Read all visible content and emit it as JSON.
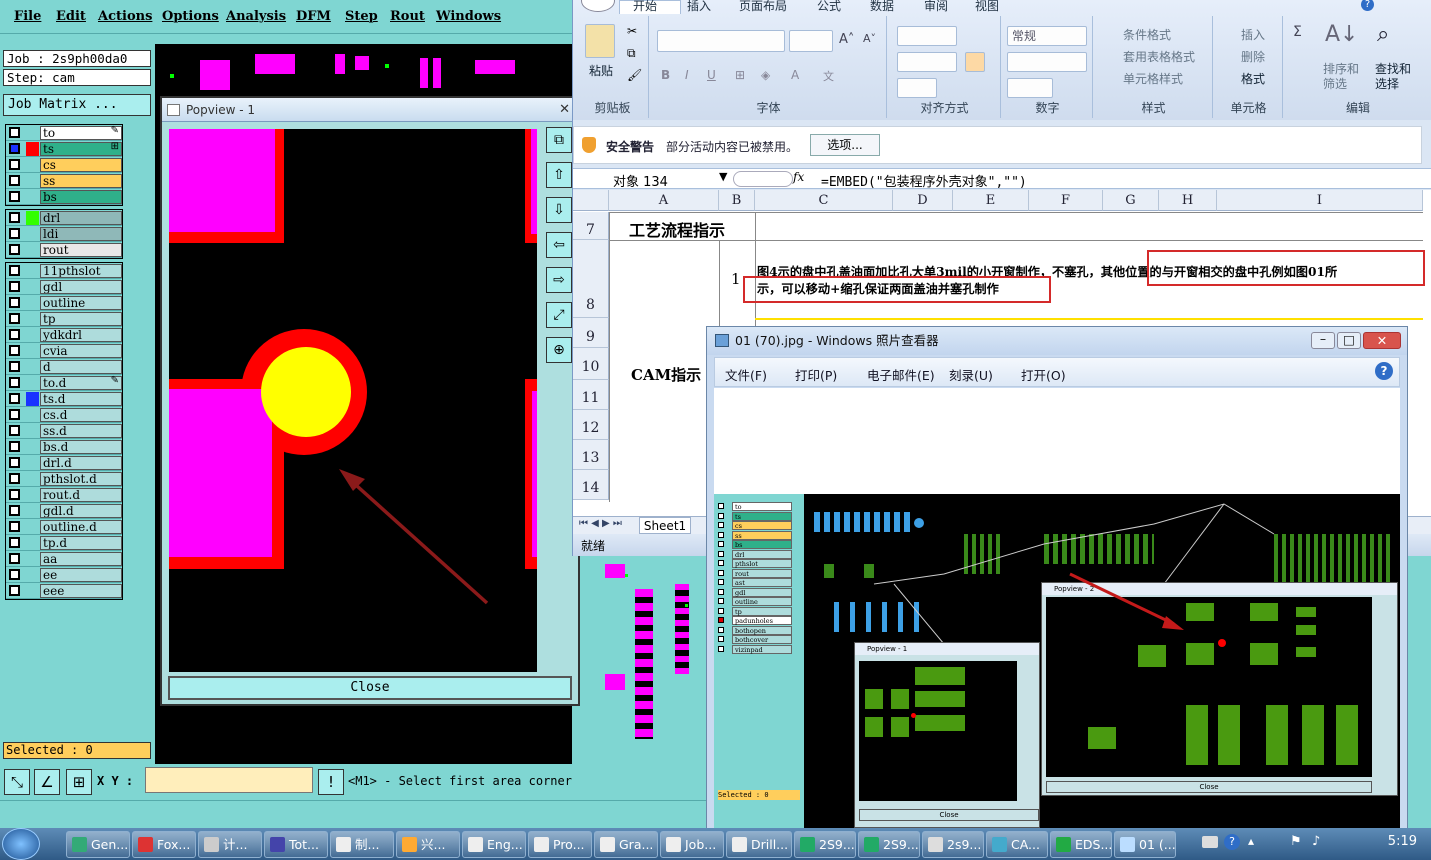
{
  "genesis": {
    "menu": [
      "File",
      "Edit",
      "Actions",
      "Options",
      "Analysis",
      "DFM",
      "Step",
      "Rout",
      "Windows"
    ],
    "job": "Job : 2s9ph00da0",
    "step": "Step: cam",
    "job_matrix": "Job Matrix ...",
    "layers_group1": [
      {
        "name": "to",
        "color": "#ffffff",
        "mark": "✎"
      },
      {
        "name": "ts",
        "color": "#ff0000",
        "mark": "⊞"
      },
      {
        "name": "cs",
        "color": "#ffce5c",
        "mark": ""
      },
      {
        "name": "ss",
        "color": "#ffce5c",
        "mark": ""
      },
      {
        "name": "bs",
        "color": "#2fb08a",
        "mark": ""
      }
    ],
    "layers_group2": [
      {
        "name": "drl",
        "color": "#33ff00"
      },
      {
        "name": "ldi",
        "color": "#8fb8b8"
      },
      {
        "name": "rout",
        "color": "#d4d4d4"
      }
    ],
    "layers_group3": [
      "11pthslot",
      "gdl",
      "outline",
      "tp",
      "ydkdrl",
      "cvia",
      "d",
      "to.d",
      "ts.d",
      "cs.d",
      "ss.d",
      "bs.d",
      "drl.d",
      "pthslot.d",
      "rout.d",
      "gdl.d",
      "outline.d",
      "tp.d",
      "aa",
      "ee",
      "eee"
    ],
    "selected": "Selected : 0",
    "xy_label": "X Y :",
    "prompt": "<M1> - Select first area corner",
    "bottom_info_key": "!"
  },
  "popview": {
    "title": "Popview - 1",
    "close": "Close",
    "close_x": "✕"
  },
  "excel": {
    "tabs": [
      "开始",
      "插入",
      "页面布局",
      "公式",
      "数据",
      "审阅",
      "视图"
    ],
    "groups": [
      "剪贴板",
      "字体",
      "对齐方式",
      "数字",
      "样式",
      "单元格",
      "编辑"
    ],
    "paste": "粘贴",
    "number_format": "常规",
    "style_items": [
      "条件格式",
      "套用表格格式",
      "单元格样式"
    ],
    "cell_items": [
      "插入",
      "删除",
      "格式"
    ],
    "edit_items": [
      "排序和筛选",
      "查找和选择"
    ],
    "security_label": "安全警告",
    "security_msg": "部分活动内容已被禁用。",
    "options_btn": "选项...",
    "namebox": "对象 134",
    "fx": "fx",
    "formula": "=EMBED(\"包装程序外壳对象\",\"\")",
    "columns": [
      "A",
      "B",
      "C",
      "D",
      "E",
      "F",
      "G",
      "H",
      "I"
    ],
    "rows": [
      "7",
      "8",
      "9",
      "10",
      "11",
      "12",
      "13",
      "14"
    ],
    "cell_a7": "工艺流程指示",
    "cell_b8": "1",
    "cell_c8_line1": "图4示的盘中孔盖油面加比孔大单3mil的小开窗制作，不塞孔，其他位置的与开窗相交的盘中孔例如图01所",
    "cell_c8_line2": "示，可以移动+缩孔保证两面盖油并塞孔制作",
    "cell_a10": "CAM指示",
    "sheet_tab": "Sheet1",
    "status": "就绪"
  },
  "photo_viewer": {
    "title": "01 (70).jpg - Windows 照片查看器",
    "menu": [
      "文件(F)",
      "打印(P)",
      "电子邮件(E)",
      "刻录(U)",
      "打开(O)"
    ],
    "help": "?",
    "inner_layers": [
      "to",
      "ts",
      "cs",
      "ss",
      "bs",
      "drl",
      "pthslot",
      "rout",
      "ast",
      "gdl",
      "outline",
      "tp",
      "padunholes",
      "bothopen",
      "bothcover",
      "vizinpad"
    ],
    "inner_selected": "Selected : 0",
    "inner_popview1": "Popview - 1",
    "inner_popview2": "Popview - 2",
    "inner_close": "Close"
  },
  "taskbar": {
    "items": [
      {
        "label": "Gen...",
        "color": "#3a7"
      },
      {
        "label": "Fox...",
        "color": "#d33"
      },
      {
        "label": "计...",
        "color": "#ccc"
      },
      {
        "label": "Tot...",
        "color": "#44a"
      },
      {
        "label": "制...",
        "color": "#eee"
      },
      {
        "label": "兴...",
        "color": "#fa3"
      },
      {
        "label": "Eng...",
        "color": "#eee"
      },
      {
        "label": "Pro...",
        "color": "#eee"
      },
      {
        "label": "Gra...",
        "color": "#eee"
      },
      {
        "label": "Job...",
        "color": "#eee"
      },
      {
        "label": "Drill...",
        "color": "#eee"
      },
      {
        "label": "2S9...",
        "color": "#2a6"
      },
      {
        "label": "2S9...",
        "color": "#2a6"
      },
      {
        "label": "2s9...",
        "color": "#ddd"
      },
      {
        "label": "CA...",
        "color": "#4ac"
      },
      {
        "label": "EDS...",
        "color": "#2a4"
      },
      {
        "label": "01 (...",
        "color": "#bdf"
      }
    ],
    "clock": "5:19"
  }
}
